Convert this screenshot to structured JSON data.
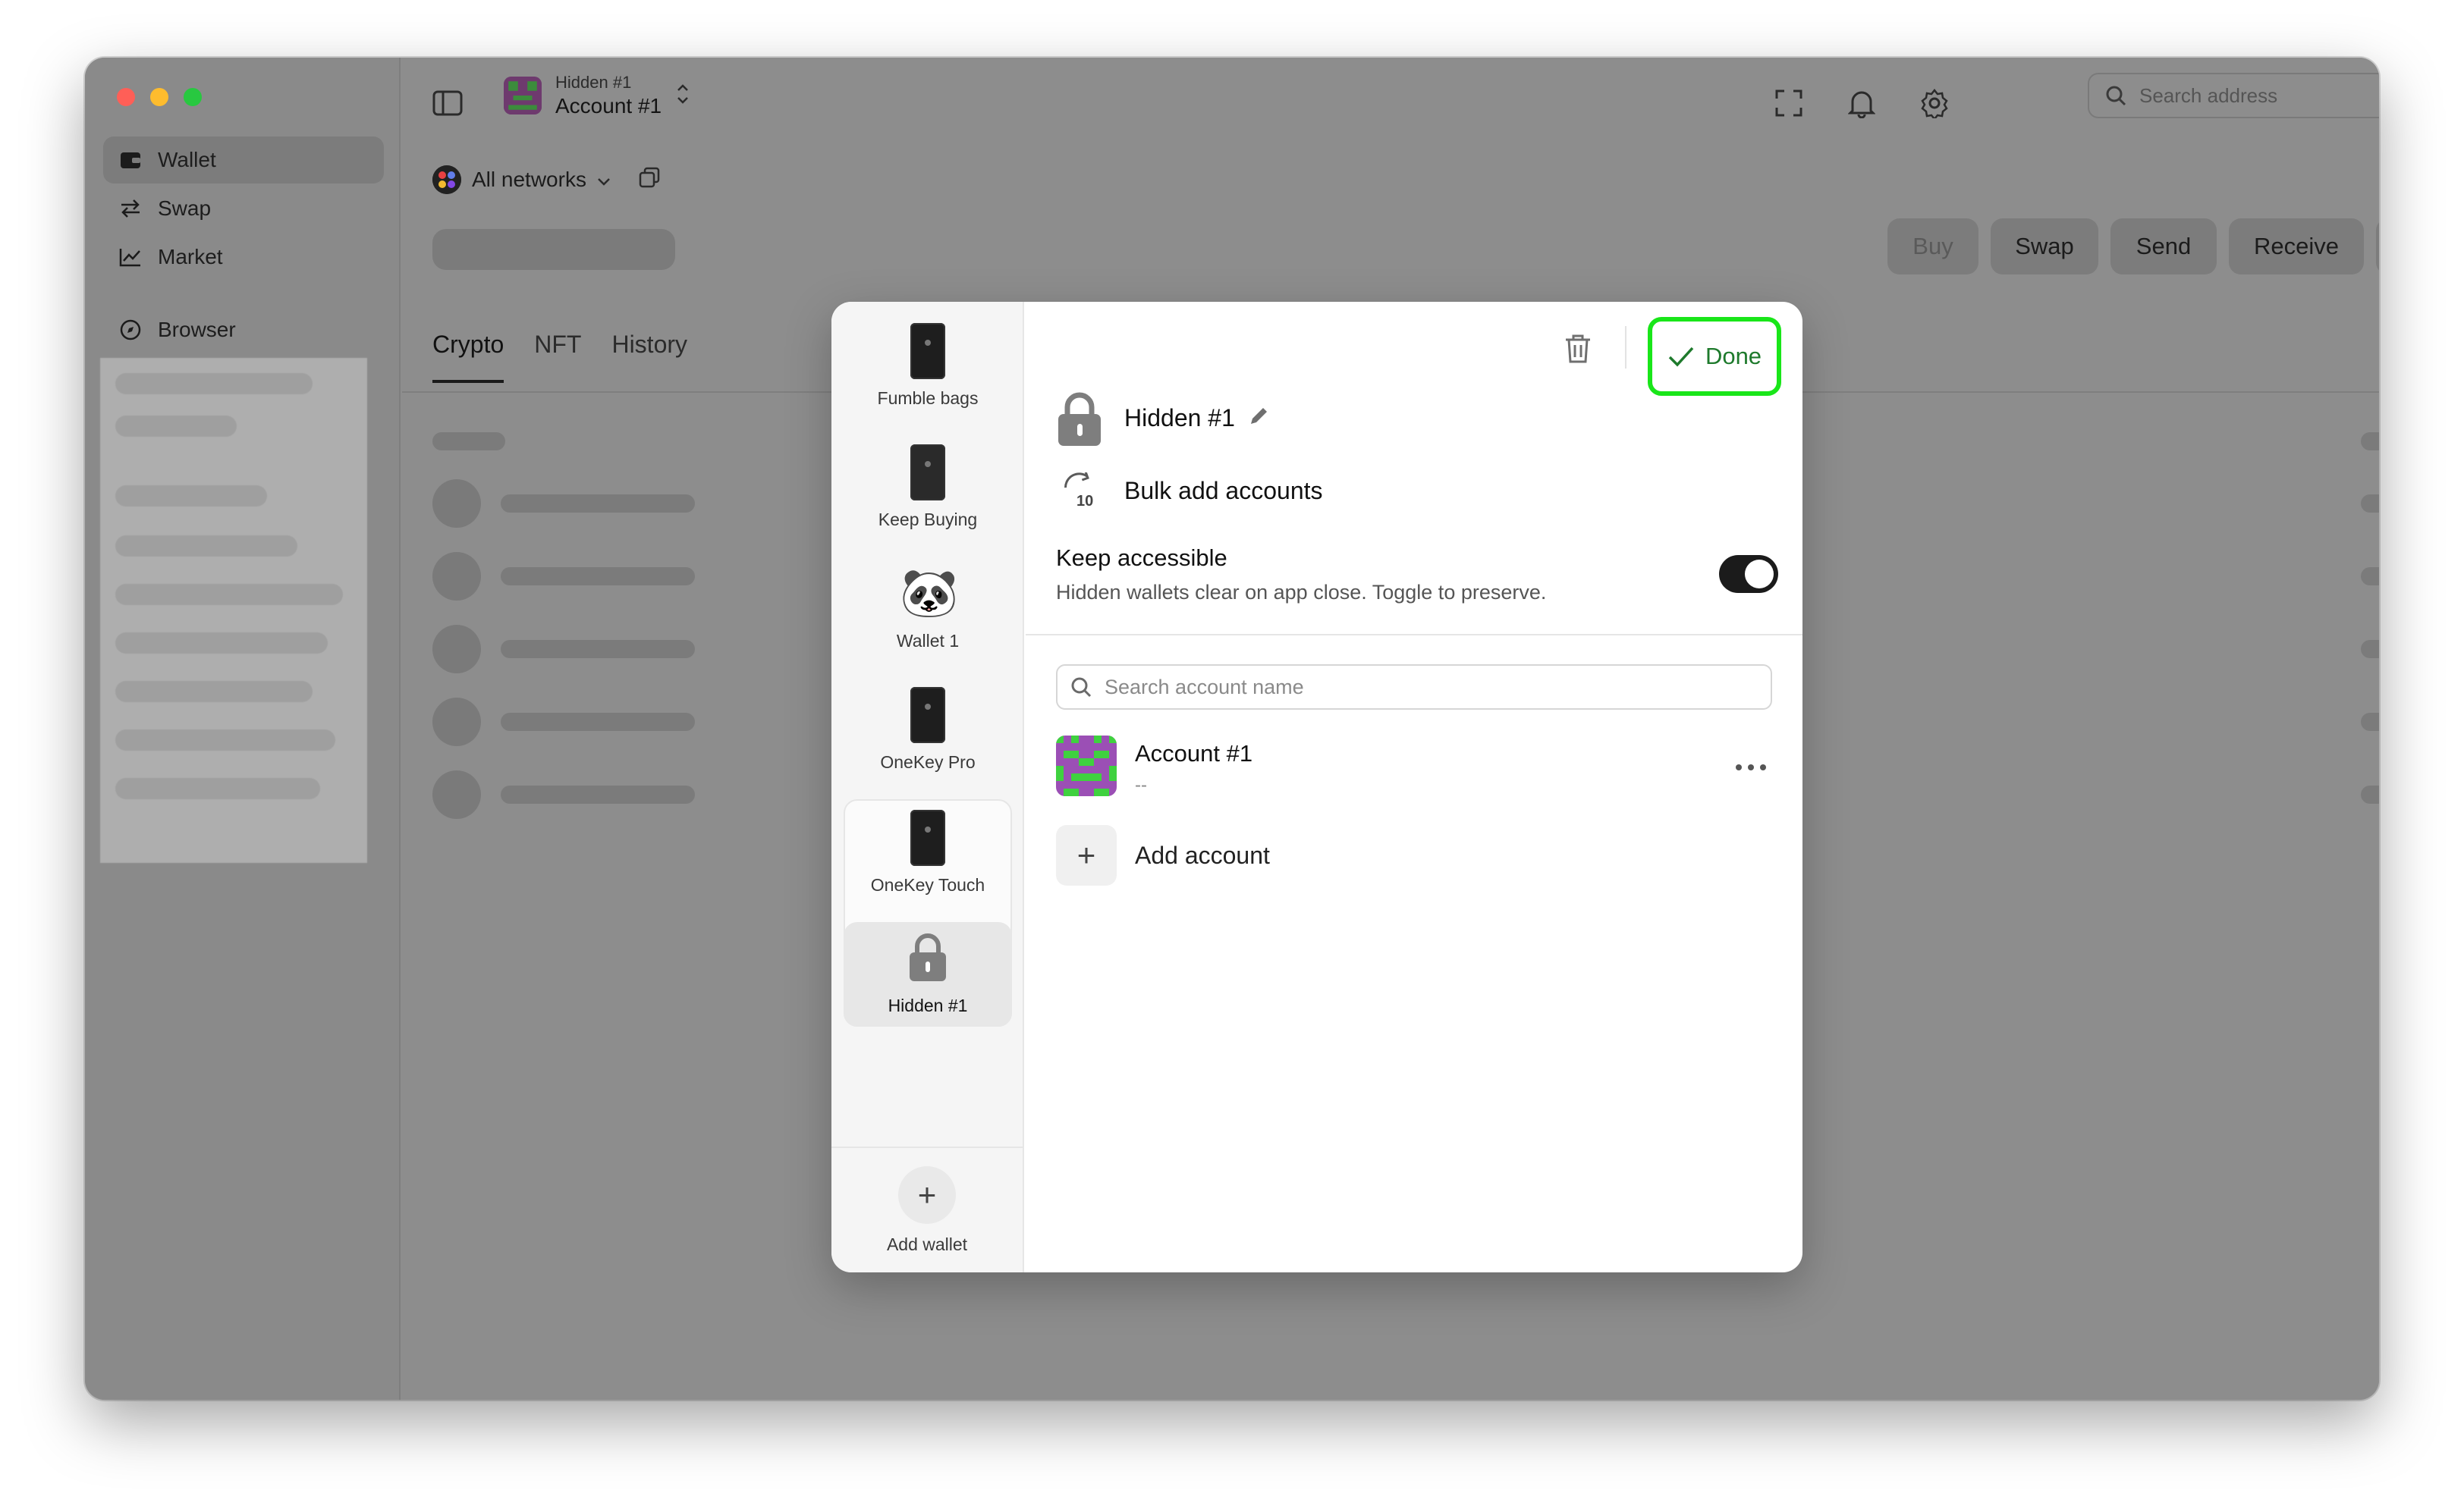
{
  "window": {
    "traffic_lights": [
      "#ff5f57",
      "#febc2e",
      "#28c840"
    ]
  },
  "sidebar": {
    "items": [
      {
        "label": "Wallet",
        "icon": "wallet-icon",
        "active": true
      },
      {
        "label": "Swap",
        "icon": "swap-arrows-icon",
        "active": false
      },
      {
        "label": "Market",
        "icon": "chart-line-icon",
        "active": false
      },
      {
        "label": "Browser",
        "icon": "compass-icon",
        "active": false
      }
    ]
  },
  "header": {
    "wallet_name": "Hidden #1",
    "account_name": "Account #1",
    "search_placeholder": "Search address",
    "icons": [
      "sidebar-toggle-icon",
      "chevron-updown-icon",
      "expand-icon",
      "bell-icon",
      "gear-icon",
      "search-icon"
    ]
  },
  "main": {
    "networks_label": "All networks",
    "tabs": [
      {
        "label": "Crypto",
        "active": true
      },
      {
        "label": "NFT",
        "active": false
      },
      {
        "label": "History",
        "active": false
      }
    ],
    "actions": [
      "Buy",
      "Swap",
      "Send",
      "Receive",
      "•••"
    ]
  },
  "modal": {
    "wallets": [
      {
        "label": "Fumble bags",
        "icon": "hardware-device-icon"
      },
      {
        "label": "Keep Buying",
        "icon": "hardware-device-icon"
      },
      {
        "label": "Wallet 1",
        "icon": "panda-emoji-icon",
        "emoji": "🐼"
      },
      {
        "label": "OneKey Pro",
        "icon": "hardware-device-icon"
      },
      {
        "label": "OneKey Touch",
        "icon": "hardware-device-icon"
      },
      {
        "label": "Hidden #1",
        "icon": "lock-icon",
        "selected": true
      }
    ],
    "add_wallet_label": "Add wallet",
    "done_label": "Done",
    "wallet_title": "Hidden #1",
    "bulk_add_label": "Bulk add accounts",
    "bulk_add_badge": "10",
    "keep_accessible_title": "Keep accessible",
    "keep_accessible_desc": "Hidden wallets clear on app close. Toggle to preserve.",
    "keep_accessible_on": true,
    "search_placeholder": "Search account name",
    "accounts": [
      {
        "name": "Account #1",
        "address": "--"
      }
    ],
    "add_account_label": "Add account",
    "accent_green": "#19e619",
    "done_text_color": "#1e7a2c"
  }
}
